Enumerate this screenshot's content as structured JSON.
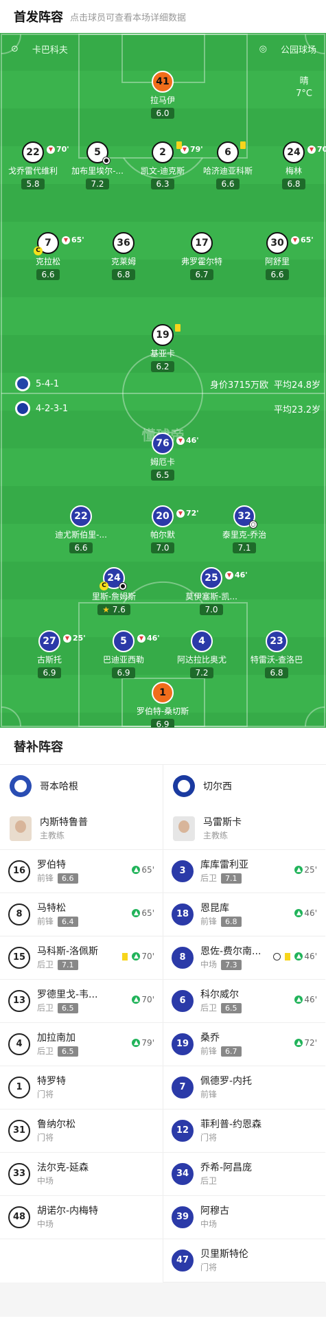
{
  "header": {
    "title": "首发阵容",
    "subtitle": "点击球员可查看本场详细数据"
  },
  "pitch": {
    "home_venue": "卡巴科夫",
    "stadium": "公园球场",
    "weather": "晴",
    "temperature": "7°C",
    "watermark": "懂球帝",
    "home_formation": "5-4-1",
    "home_value": "身价3715万欧",
    "home_avg_age": "平均24.8岁",
    "away_formation": "4-2-3-1",
    "away_avg_age": "平均23.2岁"
  },
  "home_players": [
    {
      "num": "41",
      "name": "拉马伊",
      "rating": "6.0"
    },
    {
      "num": "22",
      "name": "戈乔雷代维利",
      "rating": "5.8",
      "sub": "70'"
    },
    {
      "num": "5",
      "name": "加布里埃尔-...",
      "rating": "7.2"
    },
    {
      "num": "2",
      "name": "凯文-迪克斯",
      "rating": "6.3",
      "sub": "79'"
    },
    {
      "num": "6",
      "name": "哈济迪亚科斯",
      "rating": "6.6"
    },
    {
      "num": "24",
      "name": "梅林",
      "rating": "6.8",
      "sub": "70'"
    },
    {
      "num": "7",
      "name": "克拉松",
      "rating": "6.6",
      "sub": "65'"
    },
    {
      "num": "36",
      "name": "克莱姆",
      "rating": "6.8"
    },
    {
      "num": "17",
      "name": "弗罗霍尔特",
      "rating": "6.7"
    },
    {
      "num": "30",
      "name": "阿舒里",
      "rating": "6.6",
      "sub": "65'"
    },
    {
      "num": "19",
      "name": "基亚卡",
      "rating": "6.2"
    }
  ],
  "away_players": [
    {
      "num": "76",
      "name": "姆厄卡",
      "rating": "6.5",
      "sub": "46'"
    },
    {
      "num": "22",
      "name": "迪尤斯伯里-...",
      "rating": "6.6"
    },
    {
      "num": "20",
      "name": "帕尔默",
      "rating": "7.0",
      "sub": "72'"
    },
    {
      "num": "32",
      "name": "泰里克-乔治",
      "rating": "7.1"
    },
    {
      "num": "24",
      "name": "里斯-詹姆斯",
      "rating": "7.6"
    },
    {
      "num": "25",
      "name": "莫伊塞斯-凯...",
      "rating": "7.0",
      "sub": "46'"
    },
    {
      "num": "27",
      "name": "古斯托",
      "rating": "6.9",
      "sub": "25'"
    },
    {
      "num": "5",
      "name": "巴迪亚西勒",
      "rating": "6.9",
      "sub": "46'"
    },
    {
      "num": "4",
      "name": "阿达拉比奥尤",
      "rating": "7.2"
    },
    {
      "num": "23",
      "name": "特雷沃-查洛巴",
      "rating": "6.8"
    },
    {
      "num": "1",
      "name": "罗伯特-桑切斯",
      "rating": "6.9"
    }
  ],
  "subs": {
    "title": "替补阵容",
    "home": {
      "team": "哥本哈根",
      "coach": "内斯特鲁普",
      "coach_role": "主教练",
      "players": [
        {
          "num": "16",
          "name": "罗伯特",
          "pos": "前锋",
          "rating": "6.6",
          "on": "65'"
        },
        {
          "num": "8",
          "name": "马特松",
          "pos": "前锋",
          "rating": "6.4",
          "on": "65'"
        },
        {
          "num": "15",
          "name": "马科斯-洛佩斯",
          "pos": "后卫",
          "rating": "7.1",
          "on": "70'"
        },
        {
          "num": "13",
          "name": "罗德里戈-韦...",
          "pos": "后卫",
          "rating": "6.5",
          "on": "70'"
        },
        {
          "num": "4",
          "name": "加拉南加",
          "pos": "后卫",
          "rating": "6.5",
          "on": "79'"
        },
        {
          "num": "1",
          "name": "特罗特",
          "pos": "门将"
        },
        {
          "num": "31",
          "name": "鲁纳尔松",
          "pos": "门将"
        },
        {
          "num": "33",
          "name": "法尔克-延森",
          "pos": "中场"
        },
        {
          "num": "48",
          "name": "胡诺尔-内梅特",
          "pos": "中场"
        }
      ]
    },
    "away": {
      "team": "切尔西",
      "coach": "马雷斯卡",
      "coach_role": "主教练",
      "players": [
        {
          "num": "3",
          "name": "库库雷利亚",
          "pos": "后卫",
          "rating": "7.1",
          "on": "25'"
        },
        {
          "num": "18",
          "name": "恩昆库",
          "pos": "前锋",
          "rating": "6.8",
          "on": "46'"
        },
        {
          "num": "8",
          "name": "恩佐-费尔南...",
          "pos": "中场",
          "rating": "7.3",
          "on": "46'"
        },
        {
          "num": "6",
          "name": "科尔威尔",
          "pos": "后卫",
          "rating": "6.5",
          "on": "46'"
        },
        {
          "num": "19",
          "name": "桑乔",
          "pos": "前锋",
          "rating": "6.7",
          "on": "72'"
        },
        {
          "num": "7",
          "name": "佩德罗-内托",
          "pos": "前锋"
        },
        {
          "num": "12",
          "name": "菲利普-约恩森",
          "pos": "门将"
        },
        {
          "num": "34",
          "name": "乔希-阿昌庞",
          "pos": "后卫"
        },
        {
          "num": "39",
          "name": "阿穆古",
          "pos": "中场"
        },
        {
          "num": "47",
          "name": "贝里斯特伦",
          "pos": "门将"
        }
      ]
    }
  },
  "colors": {
    "pitch": "#36ab48",
    "away": "#2b3aa8",
    "keeper": "#f06d1b"
  }
}
